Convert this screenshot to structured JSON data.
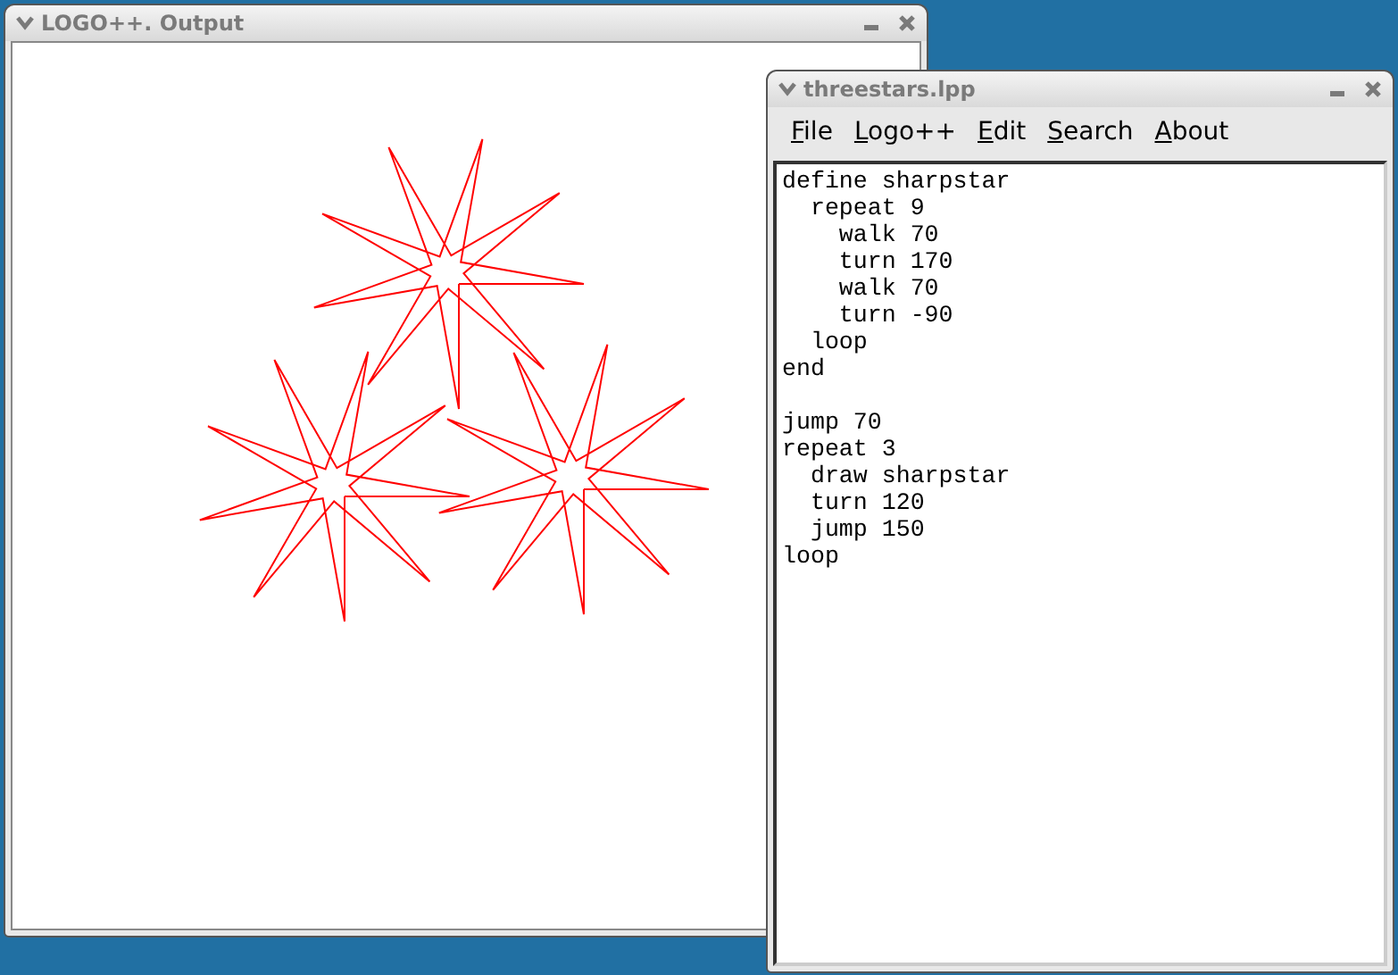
{
  "output_window": {
    "title": "LOGO++. Output"
  },
  "editor_window": {
    "title": "threestars.lpp",
    "menu": [
      "File",
      "Logo++",
      "Edit",
      "Search",
      "About"
    ],
    "code_blocks": [
      [
        "define sharpstar",
        "  repeat 9",
        "    walk 70",
        "    turn 170",
        "    walk 70",
        "    turn -90",
        "  loop",
        "end"
      ],
      [
        "jump 70",
        "repeat 3",
        "  draw sharpstar",
        "  turn 120",
        "  jump 150",
        "loop"
      ]
    ]
  }
}
